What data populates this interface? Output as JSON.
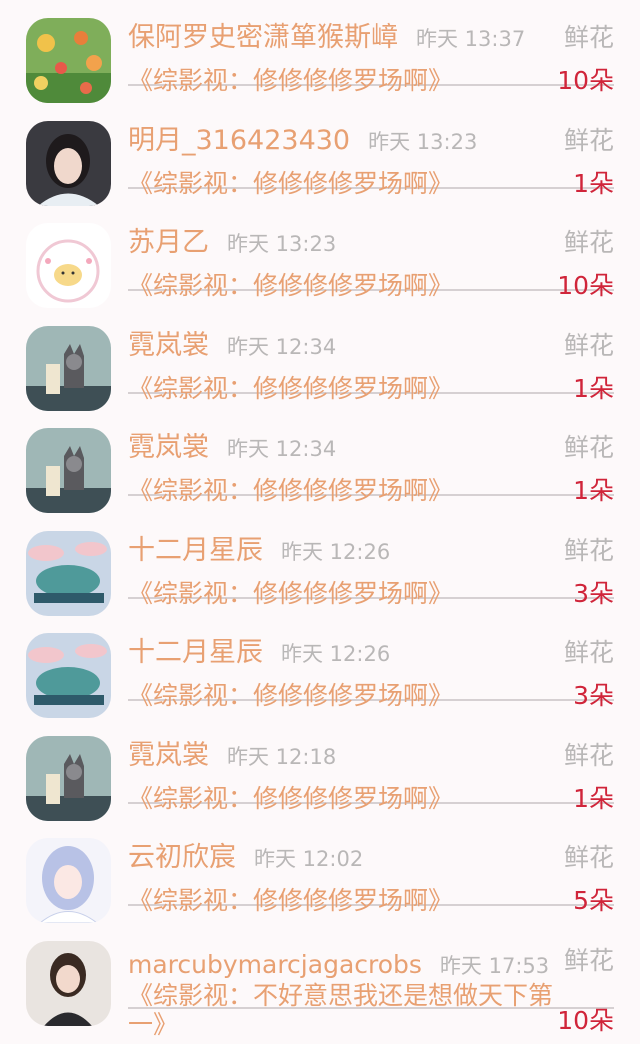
{
  "gift_label": "鲜花",
  "rows": [
    {
      "avatar": "flowers-avatar",
      "name": "保阿罗史密潇箪猴斯嶂",
      "time": "昨天 13:37",
      "book": "《综影视：修修修修罗场啊》",
      "count": "10朵"
    },
    {
      "avatar": "girl-photo-avatar",
      "name": "明月_316423430",
      "time": "昨天 13:23",
      "book": "《综影视：修修修修罗场啊》",
      "count": "1朵"
    },
    {
      "avatar": "cartoon-avatar",
      "name": "苏月乙",
      "time": "昨天 13:23",
      "book": "《综影视：修修修修罗场啊》",
      "count": "10朵"
    },
    {
      "avatar": "wolf-scroll-avatar",
      "name": "霓岚裳",
      "time": "昨天 12:34",
      "book": "《综影视：修修修修罗场啊》",
      "count": "1朵"
    },
    {
      "avatar": "wolf-scroll-avatar",
      "name": "霓岚裳",
      "time": "昨天 12:34",
      "book": "《综影视：修修修修罗场啊》",
      "count": "1朵"
    },
    {
      "avatar": "tree-clouds-avatar",
      "name": "十二月星辰",
      "time": "昨天 12:26",
      "book": "《综影视：修修修修罗场啊》",
      "count": "3朵"
    },
    {
      "avatar": "tree-clouds-avatar",
      "name": "十二月星辰",
      "time": "昨天 12:26",
      "book": "《综影视：修修修修罗场啊》",
      "count": "3朵"
    },
    {
      "avatar": "wolf-scroll-avatar",
      "name": "霓岚裳",
      "time": "昨天 12:18",
      "book": "《综影视：修修修修罗场啊》",
      "count": "1朵"
    },
    {
      "avatar": "anime-girl-avatar",
      "name": "云初欣宸",
      "time": "昨天 12:02",
      "book": "《综影视：修修修修罗场啊》",
      "count": "5朵"
    },
    {
      "avatar": "child-photo-avatar",
      "name": "marcubymarcjagacrobs",
      "time": "昨天 17:53",
      "book": "《综影视：不好意思我还是想做天下第一》",
      "count": "10朵"
    }
  ]
}
